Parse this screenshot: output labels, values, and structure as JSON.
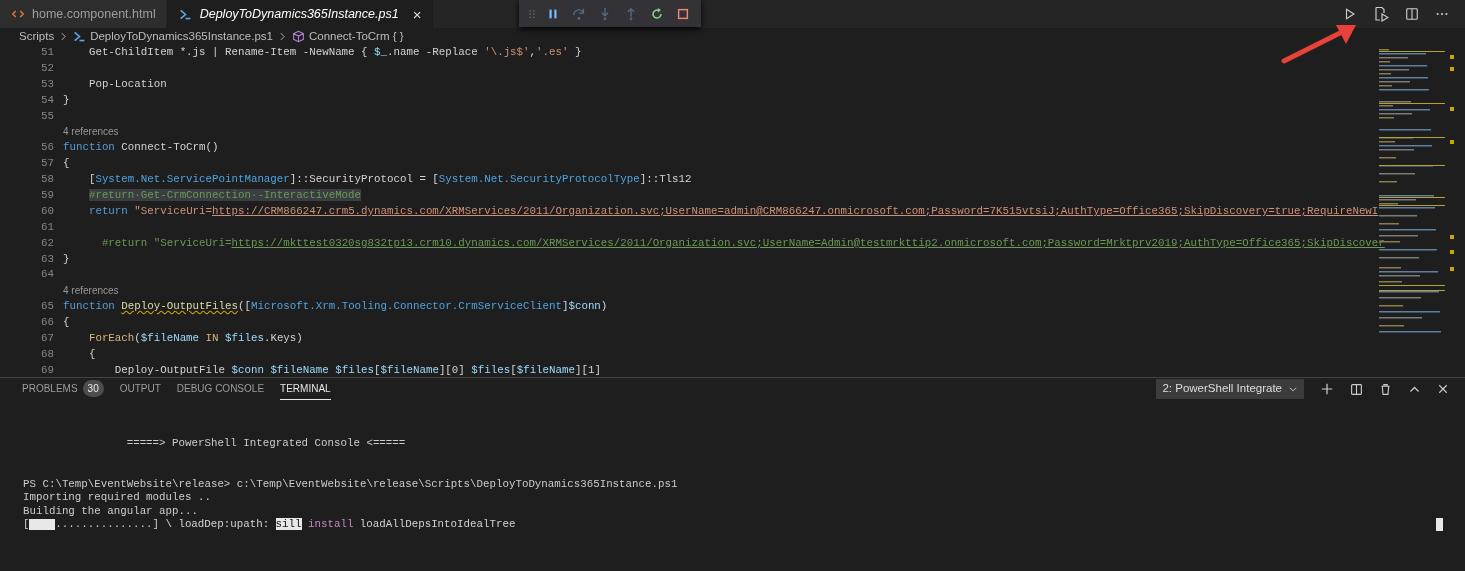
{
  "editor_tabs": [
    {
      "label": "home.component.html",
      "kind": "html",
      "selected": false
    },
    {
      "label": "DeployToDynamics365Instance.ps1",
      "kind": "powershell",
      "selected": true,
      "close": "×"
    }
  ],
  "debug_toolbar": [
    {
      "kind": "pause",
      "disabled": false
    },
    {
      "kind": "step-over",
      "disabled": true
    },
    {
      "kind": "step-into",
      "disabled": true
    },
    {
      "kind": "step-out",
      "disabled": true
    },
    {
      "kind": "restart",
      "disabled": false
    },
    {
      "kind": "stop",
      "disabled": false
    }
  ],
  "breadcrumb": [
    {
      "label": "Scripts",
      "kind": "folder"
    },
    {
      "label": "DeployToDynamics365Instance.ps1",
      "kind": "powershell"
    },
    {
      "label": "Connect-ToCrm { }",
      "kind": "function"
    }
  ],
  "editor": {
    "rows": [
      {
        "number": "51",
        "tokens": [
          {
            "kind": "plain",
            "text": "    Get-ChildItem *.js | Rename-Item -NewName { "
          },
          {
            "kind": "var",
            "text": "$_"
          },
          {
            "kind": "plain",
            "text": ".name -Replace "
          },
          {
            "kind": "string",
            "text": "'\\.js$'"
          },
          {
            "kind": "plain",
            "text": ","
          },
          {
            "kind": "string",
            "text": "'.es'"
          },
          {
            "kind": "plain",
            "text": " }"
          }
        ]
      },
      {
        "number": "52",
        "tokens": []
      },
      {
        "number": "53",
        "tokens": [
          {
            "kind": "plain",
            "text": "    Pop-Location"
          }
        ]
      },
      {
        "number": "54",
        "tokens": [
          {
            "kind": "plain",
            "text": "}"
          }
        ]
      },
      {
        "number": "55",
        "tokens": []
      },
      {
        "kind": "lens",
        "text": "4 references"
      },
      {
        "number": "56",
        "tokens": [
          {
            "kind": "keyword",
            "text": "function"
          },
          {
            "kind": "plain",
            "text": " Connect-ToCrm()"
          }
        ]
      },
      {
        "number": "57",
        "tokens": [
          {
            "kind": "plain",
            "text": "{"
          }
        ]
      },
      {
        "number": "58",
        "tokens": [
          {
            "kind": "plain",
            "text": "    ["
          },
          {
            "kind": "type",
            "text": "System.Net.ServicePointManager"
          },
          {
            "kind": "plain",
            "text": "]::SecurityProtocol = ["
          },
          {
            "kind": "type",
            "text": "System.Net.SecurityProtocolType"
          },
          {
            "kind": "plain",
            "text": "]::Tls12"
          }
        ]
      },
      {
        "number": "59",
        "tokens": [
          {
            "kind": "selected",
            "text": "    #return·Get-CrmConnection·-InteractiveMode"
          }
        ]
      },
      {
        "number": "60",
        "tokens": [
          {
            "kind": "keyword",
            "text": "    return"
          },
          {
            "kind": "string",
            "text": " \"ServiceUri="
          },
          {
            "kind": "string-link",
            "text": "https://CRM866247.crm5.dynamics.com/XRMServices/2011/Organization.svc;UserName=admin@CRM866247.onmicrosoft.com;Password=7K515vtsiJ;AuthType=Office365;SkipDiscovery=true;RequireNewI"
          }
        ]
      },
      {
        "number": "61",
        "tokens": []
      },
      {
        "number": "62",
        "tokens": [
          {
            "kind": "comment",
            "text": "      #return \"ServiceUri="
          },
          {
            "kind": "comment-link",
            "text": "https://mkttest0320sg832tp13.crm10.dynamics.com/XRMServices/2011/Organization.svc;UserName=Admin@testmrkttip2.onmicrosoft.com;Password=Mrktprv2019;AuthType=Office365;SkipDiscover"
          }
        ]
      },
      {
        "number": "63",
        "tokens": [
          {
            "kind": "plain",
            "text": "}"
          }
        ]
      },
      {
        "number": "64",
        "tokens": []
      },
      {
        "kind": "lens",
        "text": "4 references"
      },
      {
        "number": "65",
        "tokens": [
          {
            "kind": "keyword",
            "text": "function"
          },
          {
            "kind": "warning",
            "text": " Deploy-OutputFiles"
          },
          {
            "kind": "plain",
            "text": "(["
          },
          {
            "kind": "type",
            "text": "Microsoft.Xrm.Tooling.Connector.CrmServiceClient"
          },
          {
            "kind": "plain",
            "text": "]"
          },
          {
            "kind": "var",
            "text": "$conn"
          },
          {
            "kind": "plain",
            "text": ")"
          }
        ]
      },
      {
        "number": "66",
        "tokens": [
          {
            "kind": "plain",
            "text": "{"
          }
        ]
      },
      {
        "number": "67",
        "tokens": [
          {
            "kind": "control",
            "text": "    ForEach"
          },
          {
            "kind": "plain",
            "text": "("
          },
          {
            "kind": "var",
            "text": "$fileName"
          },
          {
            "kind": "control",
            "text": " IN"
          },
          {
            "kind": "var",
            "text": " $files"
          },
          {
            "kind": "plain",
            "text": ".Keys)"
          }
        ]
      },
      {
        "number": "68",
        "tokens": [
          {
            "kind": "plain",
            "text": "    {"
          }
        ]
      },
      {
        "number": "69",
        "tokens": [
          {
            "kind": "plain",
            "text": "        Deploy-OutputFile "
          },
          {
            "kind": "var",
            "text": "$conn"
          },
          {
            "kind": "var",
            "text": " $fileName"
          },
          {
            "kind": "var",
            "text": " $files"
          },
          {
            "kind": "plain",
            "text": "["
          },
          {
            "kind": "var",
            "text": "$fileName"
          },
          {
            "kind": "plain",
            "text": "][0] "
          },
          {
            "kind": "var",
            "text": "$files"
          },
          {
            "kind": "plain",
            "text": "["
          },
          {
            "kind": "var",
            "text": "$fileName"
          },
          {
            "kind": "plain",
            "text": "][1]"
          }
        ]
      }
    ]
  },
  "panel": {
    "tabs": [
      {
        "label": "PROBLEMS",
        "badge": "30",
        "selected": false
      },
      {
        "label": "OUTPUT",
        "selected": false
      },
      {
        "label": "DEBUG CONSOLE",
        "selected": false
      },
      {
        "label": "TERMINAL",
        "selected": true
      }
    ],
    "terminal_select": {
      "value": "2: PowerShell Integrate"
    }
  },
  "terminal": {
    "lines": [
      {
        "kind": "banner",
        "text": "                =====> PowerShell Integrated Console <====="
      },
      {
        "kind": "plain",
        "text": "PS C:\\Temp\\EventWebsite\\release> c:\\Temp\\EventWebsite\\release\\Scripts\\DeployToDynamics365Instance.ps1"
      },
      {
        "kind": "plain",
        "text": "Importing required modules .."
      },
      {
        "kind": "plain",
        "text": "Building the angular app..."
      }
    ],
    "progress": {
      "open": "[",
      "level": 0.21,
      "dots": "...............",
      "close": "]",
      "tokens": [
        {
          "kind": "plain",
          "text": " \\ loadDep:upath: "
        },
        {
          "kind": "inverse",
          "text": "sill"
        },
        {
          "kind": "magenta",
          "text": " install"
        },
        {
          "kind": "plain",
          "text": " loadAllDepsIntoIdealTree"
        }
      ]
    }
  }
}
